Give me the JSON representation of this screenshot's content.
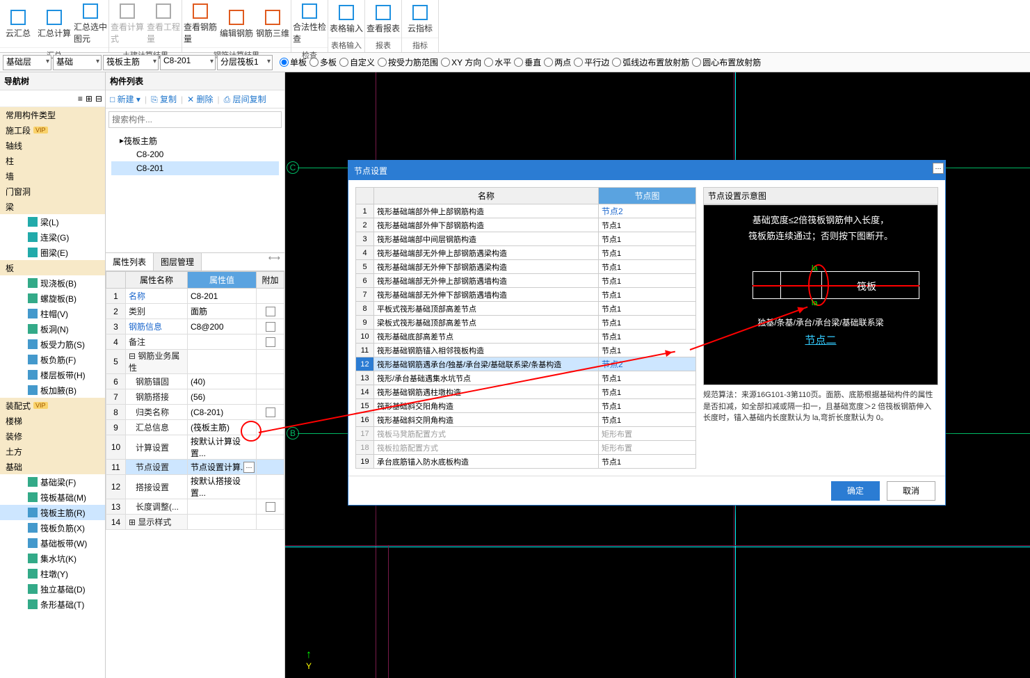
{
  "ribbon": {
    "groups": [
      {
        "label": "汇总",
        "btns": [
          {
            "t": "云汇总",
            "c": "#1e90e0"
          },
          {
            "t": "汇总计算",
            "c": "#1e90e0"
          },
          {
            "t": "汇总选中图元",
            "c": "#1e90e0"
          }
        ]
      },
      {
        "label": "土建计算结果",
        "btns": [
          {
            "t": "查看计算式",
            "c": "#aaa"
          },
          {
            "t": "查看工程量",
            "c": "#aaa"
          }
        ]
      },
      {
        "label": "钢筋计算结果",
        "btns": [
          {
            "t": "查看钢筋量",
            "c": "#e05a1e"
          },
          {
            "t": "编辑钢筋",
            "c": "#e05a1e"
          },
          {
            "t": "钢筋三维",
            "c": "#e05a1e"
          }
        ]
      },
      {
        "label": "检查",
        "btns": [
          {
            "t": "合法性检查",
            "c": "#1e90e0"
          }
        ]
      },
      {
        "label": "表格输入",
        "btns": [
          {
            "t": "表格输入",
            "c": "#1e90e0"
          }
        ]
      },
      {
        "label": "报表",
        "btns": [
          {
            "t": "查看报表",
            "c": "#1e90e0"
          }
        ]
      },
      {
        "label": "指标",
        "btns": [
          {
            "t": "云指标",
            "c": "#1e90e0"
          }
        ]
      }
    ]
  },
  "combos": [
    "基础层",
    "基础",
    "筏板主筋",
    "C8-201",
    "分层筏板1"
  ],
  "radios": [
    "单板",
    "多板",
    "自定义",
    "按受力筋范围",
    "XY 方向",
    "水平",
    "垂直",
    "两点",
    "平行边",
    "弧线边布置放射筋",
    "圆心布置放射筋"
  ],
  "radio_checked": 0,
  "nav": {
    "title": "导航树",
    "items": [
      {
        "t": "常用构件类型",
        "lvl": 0,
        "band": true
      },
      {
        "t": "施工段",
        "lvl": 0,
        "band": true,
        "vip": true
      },
      {
        "t": "轴线",
        "lvl": 0,
        "band": true
      },
      {
        "t": "柱",
        "lvl": 0,
        "band": true
      },
      {
        "t": "墙",
        "lvl": 0,
        "band": true
      },
      {
        "t": "门窗洞",
        "lvl": 0,
        "band": true
      },
      {
        "t": "梁",
        "lvl": 0,
        "band": true
      },
      {
        "t": "梁(L)",
        "lvl": 2,
        "ic": "#2aa"
      },
      {
        "t": "连梁(G)",
        "lvl": 2,
        "ic": "#2aa"
      },
      {
        "t": "圈梁(E)",
        "lvl": 2,
        "ic": "#2aa"
      },
      {
        "t": "板",
        "lvl": 0,
        "band": true
      },
      {
        "t": "现浇板(B)",
        "lvl": 2,
        "ic": "#3a8"
      },
      {
        "t": "螺旋板(B)",
        "lvl": 2,
        "ic": "#3a8"
      },
      {
        "t": "柱帽(V)",
        "lvl": 2,
        "ic": "#49c"
      },
      {
        "t": "板洞(N)",
        "lvl": 2,
        "ic": "#3a8"
      },
      {
        "t": "板受力筋(S)",
        "lvl": 2,
        "ic": "#49c"
      },
      {
        "t": "板负筋(F)",
        "lvl": 2,
        "ic": "#49c"
      },
      {
        "t": "楼层板带(H)",
        "lvl": 2,
        "ic": "#49c"
      },
      {
        "t": "板加腋(B)",
        "lvl": 2,
        "ic": "#49c"
      },
      {
        "t": "装配式",
        "lvl": 0,
        "band": true,
        "vip": true
      },
      {
        "t": "楼梯",
        "lvl": 0,
        "band": true
      },
      {
        "t": "装修",
        "lvl": 0,
        "band": true
      },
      {
        "t": "土方",
        "lvl": 0,
        "band": true
      },
      {
        "t": "基础",
        "lvl": 0,
        "band": true
      },
      {
        "t": "基础梁(F)",
        "lvl": 2,
        "ic": "#3a8"
      },
      {
        "t": "筏板基础(M)",
        "lvl": 2,
        "ic": "#3a8"
      },
      {
        "t": "筏板主筋(R)",
        "lvl": 2,
        "ic": "#49c",
        "sel": true
      },
      {
        "t": "筏板负筋(X)",
        "lvl": 2,
        "ic": "#49c"
      },
      {
        "t": "基础板带(W)",
        "lvl": 2,
        "ic": "#49c"
      },
      {
        "t": "集水坑(K)",
        "lvl": 2,
        "ic": "#3a8"
      },
      {
        "t": "柱墩(Y)",
        "lvl": 2,
        "ic": "#3a8"
      },
      {
        "t": "独立基础(D)",
        "lvl": 2,
        "ic": "#3a8"
      },
      {
        "t": "条形基础(T)",
        "lvl": 2,
        "ic": "#3a8"
      }
    ]
  },
  "complist": {
    "title": "构件列表",
    "btns": [
      "新建",
      "复制",
      "删除",
      "层间复制"
    ],
    "search_ph": "搜索构件...",
    "root": "筏板主筋",
    "items": [
      "C8-200",
      "C8-201"
    ],
    "sel": 1
  },
  "prop": {
    "tabs": [
      "属性列表",
      "图层管理"
    ],
    "cols": [
      "属性名称",
      "属性值",
      "附加"
    ],
    "rows": [
      {
        "n": "名称",
        "v": "C8-201",
        "blue": true
      },
      {
        "n": "类别",
        "v": "面筋",
        "chk": true
      },
      {
        "n": "钢筋信息",
        "v": "C8@200",
        "blue": true,
        "chk": true
      },
      {
        "n": "备注",
        "v": "",
        "chk": true
      },
      {
        "n": "钢筋业务属性",
        "v": "",
        "grp": true
      },
      {
        "n": "钢筋锚固",
        "v": "(40)",
        "ind": true
      },
      {
        "n": "钢筋搭接",
        "v": "(56)",
        "ind": true
      },
      {
        "n": "归类名称",
        "v": "(C8-201)",
        "ind": true,
        "chk": true
      },
      {
        "n": "汇总信息",
        "v": "(筏板主筋)",
        "ind": true
      },
      {
        "n": "计算设置",
        "v": "按默认计算设置...",
        "ind": true
      },
      {
        "n": "节点设置",
        "v": "节点设置计算...",
        "ind": true,
        "sel": true,
        "btn": true
      },
      {
        "n": "搭接设置",
        "v": "按默认搭接设置...",
        "ind": true
      },
      {
        "n": "长度调整(...",
        "v": "",
        "ind": true,
        "chk": true
      },
      {
        "n": "显示样式",
        "v": "",
        "grp": true,
        "plus": true
      }
    ]
  },
  "dialog": {
    "title": "节点设置",
    "cols": [
      "名称",
      "节点图"
    ],
    "rows": [
      {
        "n": "筏形基础端部外伸上部钢筋构造",
        "v": "节点2",
        "link": true
      },
      {
        "n": "筏形基础端部外伸下部钢筋构造",
        "v": "节点1"
      },
      {
        "n": "筏形基础端部中间层钢筋构造",
        "v": "节点1"
      },
      {
        "n": "筏形基础端部无外伸上部钢筋遇梁构造",
        "v": "节点1"
      },
      {
        "n": "筏形基础端部无外伸下部钢筋遇梁构造",
        "v": "节点1"
      },
      {
        "n": "筏形基础端部无外伸上部钢筋遇墙构造",
        "v": "节点1"
      },
      {
        "n": "筏形基础端部无外伸下部钢筋遇墙构造",
        "v": "节点1"
      },
      {
        "n": "平板式筏形基础顶部高差节点",
        "v": "节点1"
      },
      {
        "n": "梁板式筏形基础顶部高差节点",
        "v": "节点1"
      },
      {
        "n": "筏形基础底部高差节点",
        "v": "节点1"
      },
      {
        "n": "筏形基础钢筋锚入相邻筏板构造",
        "v": "节点1"
      },
      {
        "n": "筏形基础钢筋遇承台/独基/承台梁/基础联系梁/条基构造",
        "v": "节点2",
        "sel": true,
        "link": true,
        "btn": true
      },
      {
        "n": "筏形/承台基础遇集水坑节点",
        "v": "节点1"
      },
      {
        "n": "筏形基础钢筋遇柱墩构造",
        "v": "节点1"
      },
      {
        "n": "筏形基础斜交阳角构造",
        "v": "节点1"
      },
      {
        "n": "筏形基础斜交阴角构造",
        "v": "节点1"
      },
      {
        "n": "筏板马凳筋配置方式",
        "v": "矩形布置",
        "dis": true
      },
      {
        "n": "筏板拉筋配置方式",
        "v": "矩形布置",
        "dis": true
      },
      {
        "n": "承台底筋锚入防水底板构造",
        "v": "节点1"
      }
    ],
    "preview_title": "节点设置示意图",
    "preview_line1": "基础宽度≤2倍筏板钢筋伸入长度，",
    "preview_line2": "筏板筋连续通过；否则按下图断开。",
    "preview_label_fb": "筏板",
    "preview_label_bot": "独基/条基/承台/承台梁/基础联系梁",
    "preview_node": "节点二",
    "desc": "规范算法：来源16G101-3第110页。面筋、底筋根据基础构件的属性是否扣减，如全部扣减或隔一扣一，且基础宽度＞2 倍筏板钢筋伸入长度时，锚入基础内长度默认为 la,弯折长度默认为 0。",
    "ok": "确定",
    "cancel": "取消"
  },
  "markers": {
    "B": "B",
    "C": "C"
  }
}
